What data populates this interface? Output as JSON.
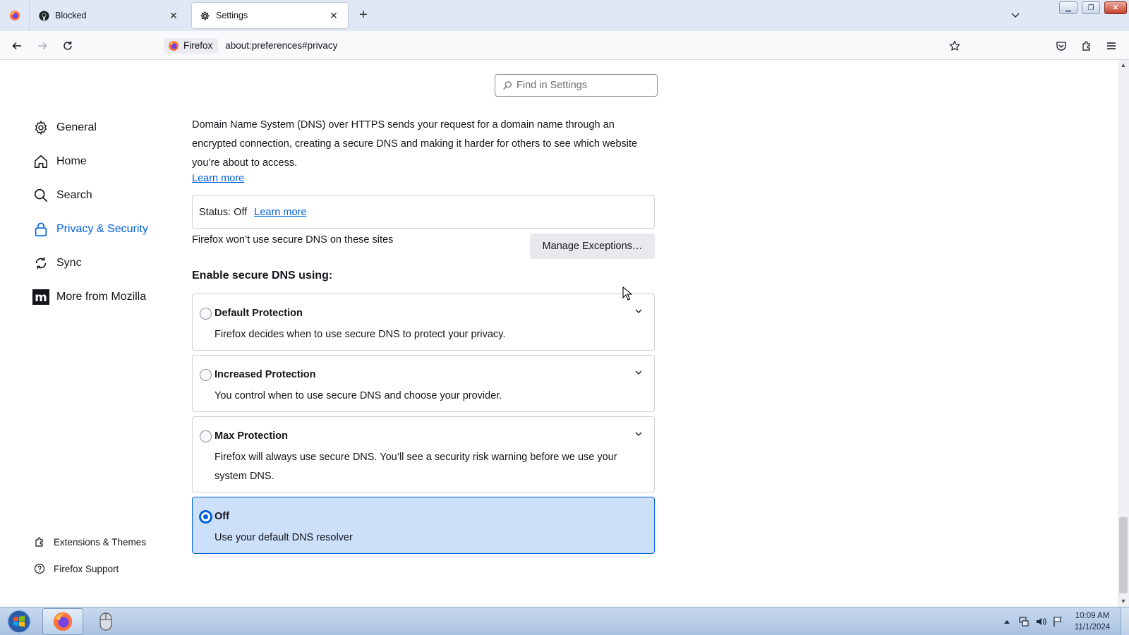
{
  "tabs": [
    {
      "title": "Blocked",
      "icon": "github-icon"
    },
    {
      "title": "Settings",
      "icon": "gear-icon"
    }
  ],
  "urlbar": {
    "identity_label": "Firefox",
    "url": "about:preferences#privacy"
  },
  "search": {
    "placeholder": "Find in Settings"
  },
  "sidebar": {
    "items": [
      {
        "label": "General",
        "icon": "gear-icon"
      },
      {
        "label": "Home",
        "icon": "home-icon"
      },
      {
        "label": "Search",
        "icon": "search-icon"
      },
      {
        "label": "Privacy & Security",
        "icon": "lock-icon",
        "selected": true
      },
      {
        "label": "Sync",
        "icon": "sync-icon"
      },
      {
        "label": "More from Mozilla",
        "icon": "mozilla-icon"
      }
    ],
    "footer": [
      {
        "label": "Extensions & Themes",
        "icon": "puzzle-icon"
      },
      {
        "label": "Firefox Support",
        "icon": "help-icon"
      }
    ]
  },
  "dns": {
    "description": "Domain Name System (DNS) over HTTPS sends your request for a domain name through an encrypted connection, creating a secure DNS and making it harder for others to see which website you’re about to access.",
    "learn_more": "Learn more",
    "status": "Status: Off",
    "status_learn_more": "Learn more",
    "exceptions_text": "Firefox won’t use secure DNS on these sites",
    "manage_button": "Manage Exceptions…",
    "enable_heading": "Enable secure DNS using:",
    "options": [
      {
        "title": "Default Protection",
        "desc": "Firefox decides when to use secure DNS to protect your privacy.",
        "selected": false
      },
      {
        "title": "Increased Protection",
        "desc": "You control when to use secure DNS and choose your provider.",
        "selected": false
      },
      {
        "title": "Max Protection",
        "desc": "Firefox will always use secure DNS. You’ll see a security risk warning before we use your system DNS.",
        "selected": false
      },
      {
        "title": "Off",
        "desc": "Use your default DNS resolver",
        "selected": true
      }
    ]
  },
  "taskbar": {
    "time": "10:09 AM",
    "date": "11/1/2024"
  },
  "colors": {
    "accent": "#0061e0",
    "selected_option_bg": "#cce0fa",
    "tabstrip_bg": "#dfe8f4"
  }
}
